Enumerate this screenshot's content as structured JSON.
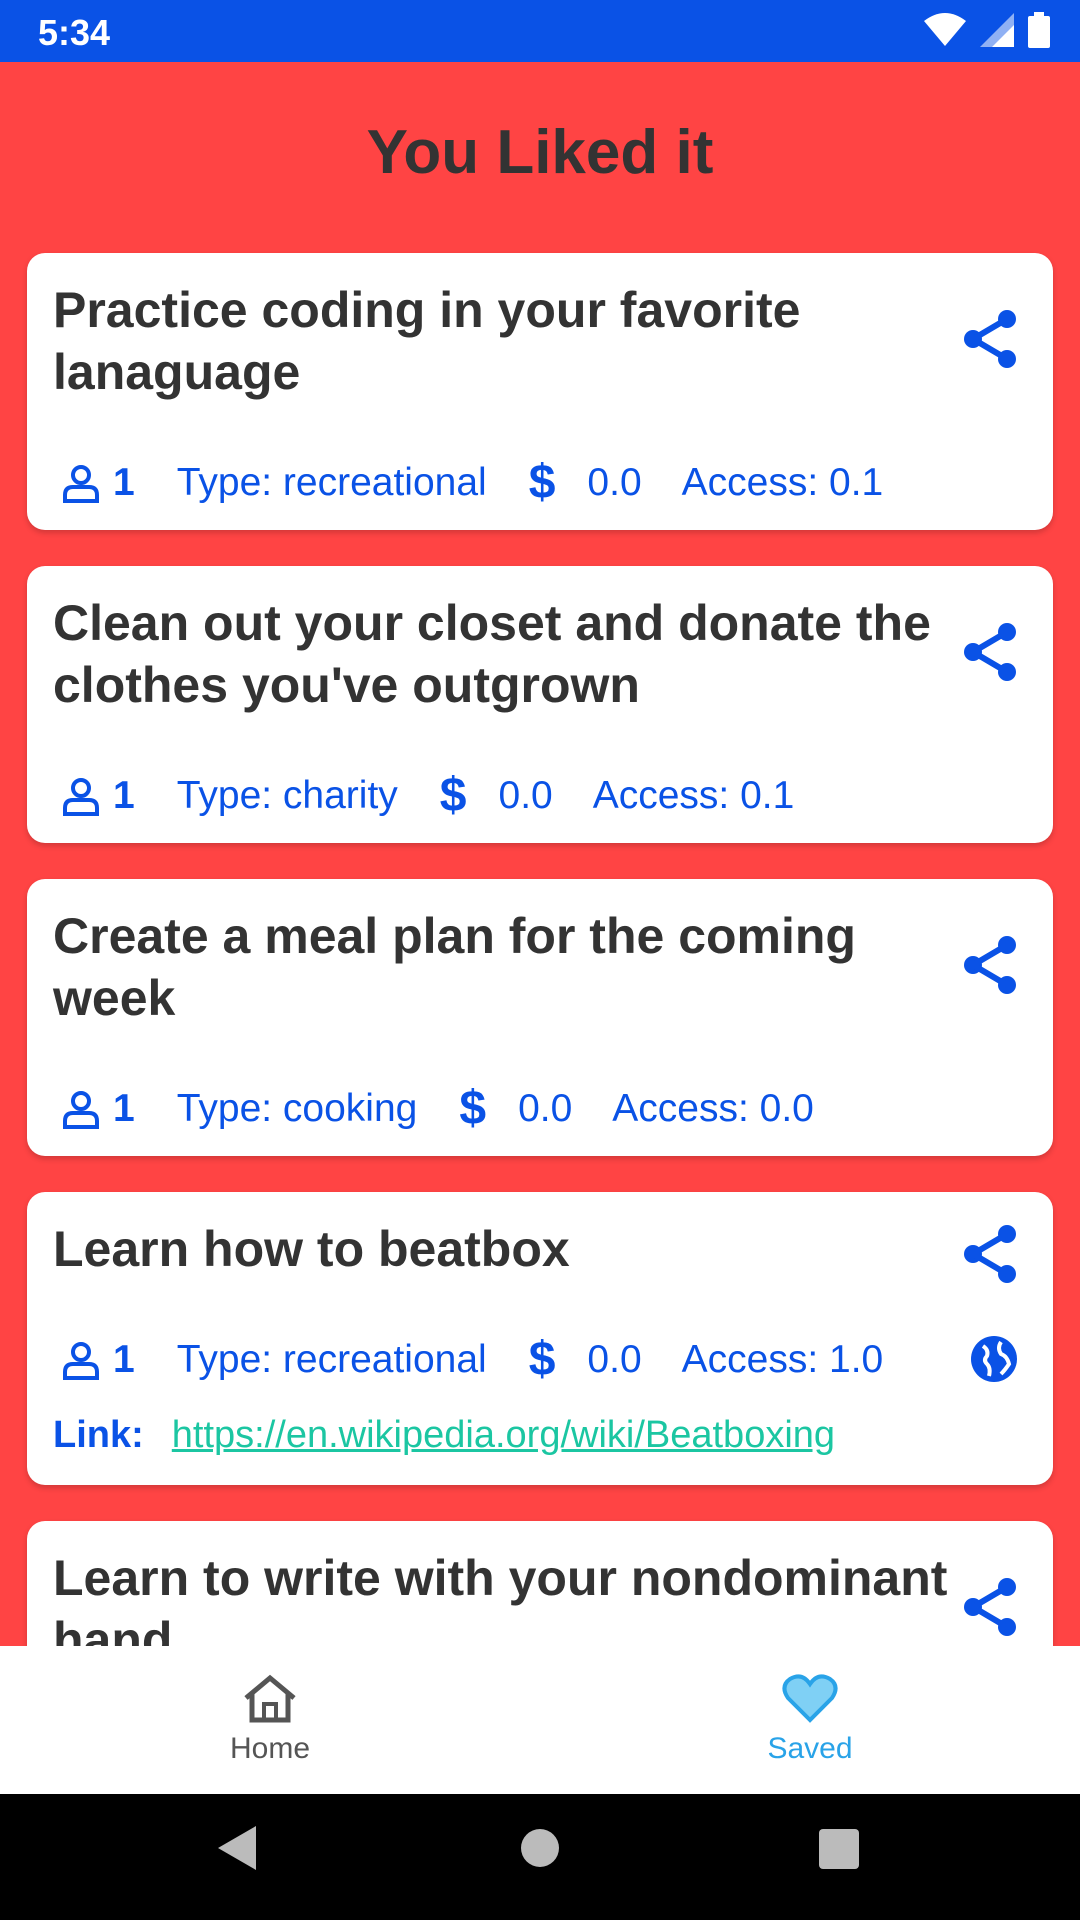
{
  "status": {
    "time": "5:34"
  },
  "header": {
    "title": "You Liked it"
  },
  "colors": {
    "background": "#ff4444",
    "accent": "#0a52e6",
    "link": "#1bc6a2",
    "saved": "#29a3e8"
  },
  "cards": [
    {
      "title": "Practice coding in your favorite lanaguage",
      "participants": "1",
      "type": "Type: recreational",
      "price": "0.0",
      "access": "Access: 0.1"
    },
    {
      "title": "Clean out your closet and donate the clothes you've outgrown",
      "participants": "1",
      "type": "Type: charity",
      "price": "0.0",
      "access": "Access: 0.1"
    },
    {
      "title": "Create a meal plan for the coming week",
      "participants": "1",
      "type": "Type: cooking",
      "price": "0.0",
      "access": "Access: 0.0"
    },
    {
      "title": "Learn how to beatbox",
      "participants": "1",
      "type": "Type: recreational",
      "price": "0.0",
      "access": "Access: 1.0",
      "link_label": "Link:",
      "link_url": "https://en.wikipedia.org/wiki/Beatboxing"
    },
    {
      "title": "Learn to write with your nondominant hand"
    }
  ],
  "nav": {
    "home": "Home",
    "saved": "Saved"
  },
  "icons": {
    "share": "share-icon",
    "person": "person-icon",
    "globe": "globe-icon",
    "home": "home-icon",
    "heart": "heart-icon"
  }
}
